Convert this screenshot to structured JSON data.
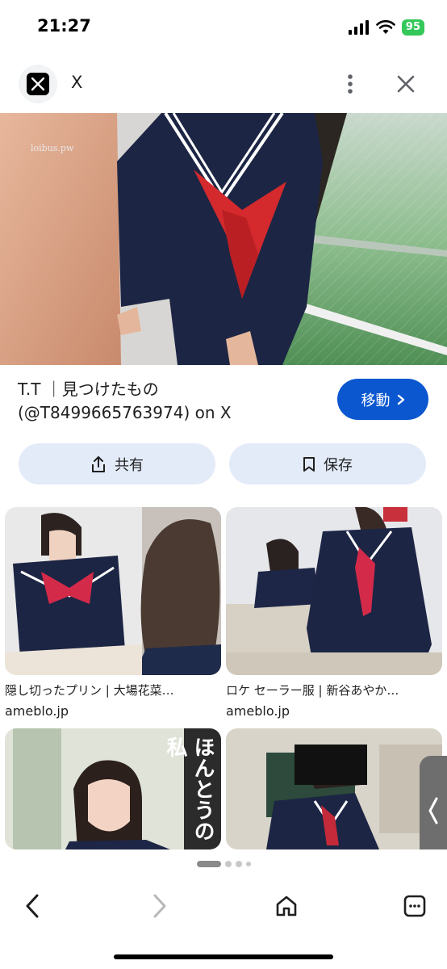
{
  "status": {
    "time": "21:27",
    "battery": "95"
  },
  "header": {
    "site_name": "X",
    "logo_icon": "x-logo-icon",
    "more_icon": "more-vertical-icon",
    "close_icon": "close-icon"
  },
  "main_image": {
    "watermark": "loibus.pw"
  },
  "result": {
    "title": "T.T ｜見つけたもの (@T8499665763974) on X",
    "visit_label": "移動",
    "share_label": "共有",
    "save_label": "保存"
  },
  "related": [
    {
      "title": "隠し切ったプリン | 大場花菜…",
      "source": "ameblo.jp"
    },
    {
      "title": "ロケ セーラー服 | 新谷あやか…",
      "source": "ameblo.jp"
    },
    {
      "overlay_text": "ほんとうの私"
    },
    {}
  ],
  "pagination": {
    "active_index": 0,
    "count": 4
  },
  "bottom_nav": {
    "back_icon": "back-arrow-icon",
    "forward_icon": "forward-arrow-icon",
    "home_icon": "home-icon",
    "tabs_icon": "tabs-icon"
  },
  "colors": {
    "accent": "#0b57d0",
    "chip_bg": "#e3ebf9",
    "battery": "#34c759"
  }
}
